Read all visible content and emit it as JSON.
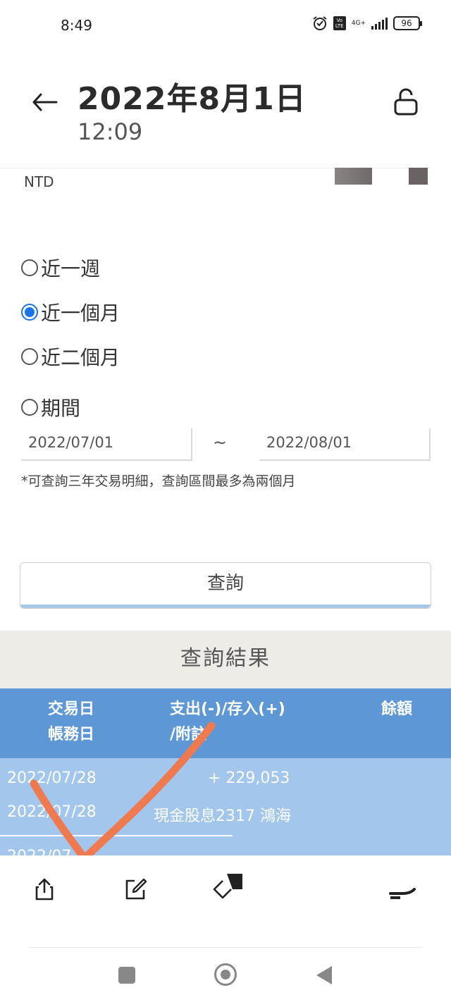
{
  "status_bar": {
    "time": "8:49",
    "network": "4G+",
    "volte": "Vo LTE",
    "battery": "96"
  },
  "header": {
    "title": "2022年8月1日",
    "subtitle": "12:09"
  },
  "account": {
    "currency": "NTD"
  },
  "period_options": [
    {
      "label": "近一週",
      "checked": false
    },
    {
      "label": "近一個月",
      "checked": true
    },
    {
      "label": "近二個月",
      "checked": false
    },
    {
      "label": "期間",
      "checked": false
    }
  ],
  "date_range": {
    "start": "2022/07/01",
    "separator": "~",
    "end": "2022/08/01",
    "note": "*可查詢三年交易明細，查詢區間最多為兩個月"
  },
  "query_button": "查詢",
  "results": {
    "title": "查詢結果",
    "headers": {
      "date_line1": "交易日",
      "date_line2": "帳務日",
      "amount_line1": "支出(-)/存入(+)",
      "amount_line2": "/附註",
      "balance": "餘額"
    },
    "rows": [
      {
        "trade_date": "2022/07/28",
        "amount": "+ 229,053",
        "post_date": "2022/07/28",
        "memo": "現金股息2317 鴻海"
      }
    ],
    "partial_row": "2022/07"
  },
  "colors": {
    "accent": "#1a73e8",
    "table_header": "#5d97d6",
    "table_rows": "#a2c6ec",
    "results_bar": "#efebe6",
    "annotation": "#f07a4f"
  }
}
